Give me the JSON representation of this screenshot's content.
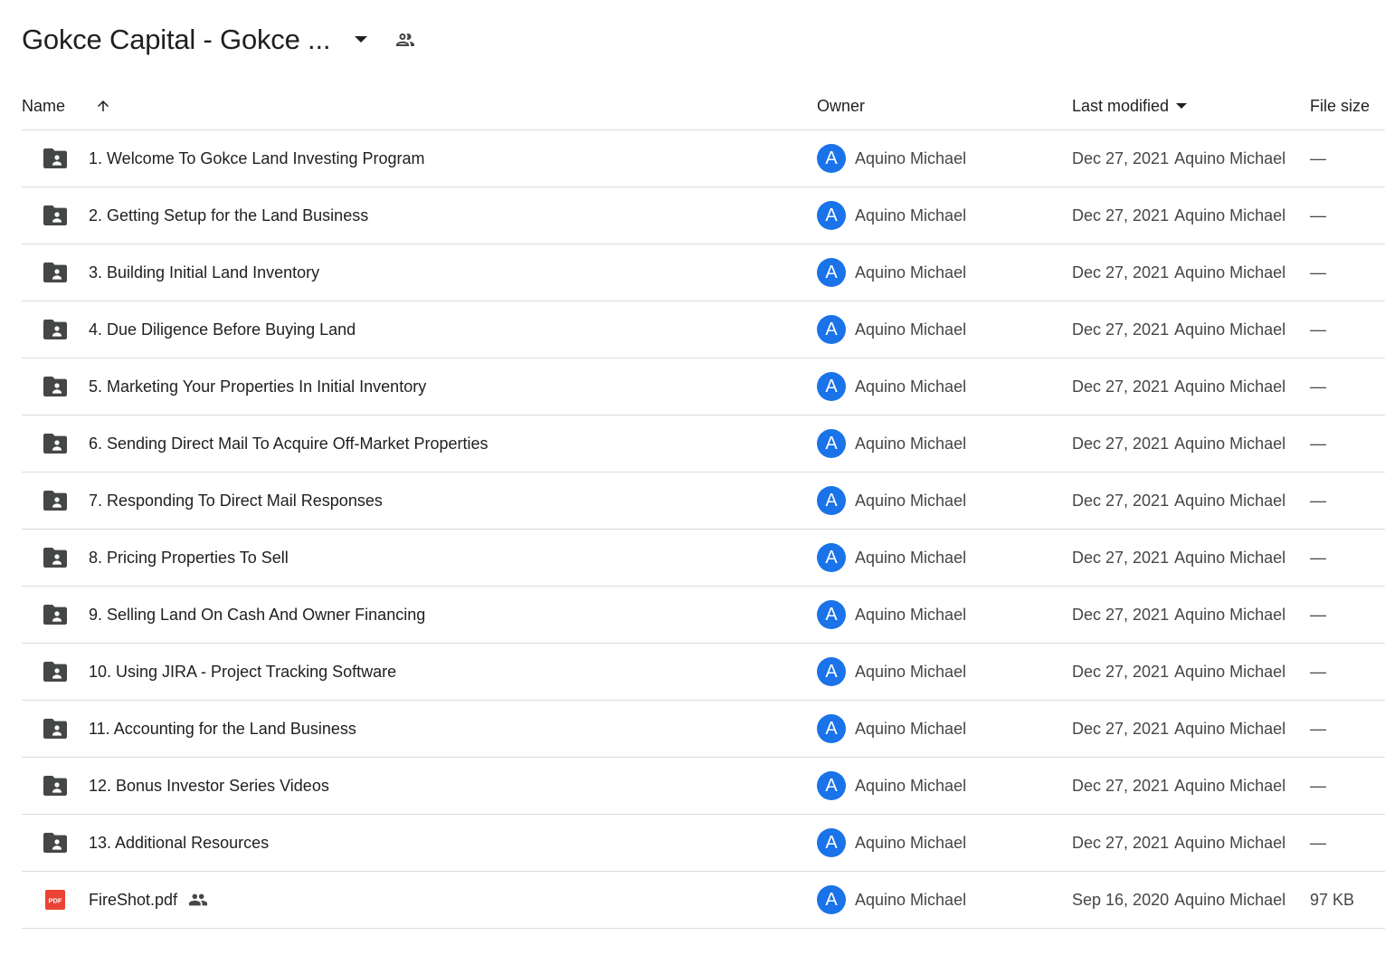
{
  "header": {
    "title": "Gokce Capital - Gokce ...",
    "caret_icon": "arrow-drop-down-icon",
    "shared_icon": "people-icon"
  },
  "columns": {
    "name": "Name",
    "owner": "Owner",
    "last_modified": "Last modified",
    "file_size": "File size",
    "sort_icon": "arrow-up-icon"
  },
  "colors": {
    "avatar_bg": "#1a73e8",
    "folder_icon": "#444746",
    "pdf_icon": "#ea4335",
    "divider": "#dadce0"
  },
  "rows": [
    {
      "type": "folder",
      "name": "1. Welcome To Gokce Land Investing Program",
      "owner_initial": "A",
      "owner": "Aquino Michael",
      "modified_date": "Dec 27, 2021",
      "modified_by": "Aquino Michael",
      "size": "—"
    },
    {
      "type": "folder",
      "name": "2. Getting Setup for the Land Business",
      "owner_initial": "A",
      "owner": "Aquino Michael",
      "modified_date": "Dec 27, 2021",
      "modified_by": "Aquino Michael",
      "size": "—"
    },
    {
      "type": "folder",
      "name": "3. Building Initial Land Inventory",
      "owner_initial": "A",
      "owner": "Aquino Michael",
      "modified_date": "Dec 27, 2021",
      "modified_by": "Aquino Michael",
      "size": "—"
    },
    {
      "type": "folder",
      "name": "4. Due Diligence Before Buying Land",
      "owner_initial": "A",
      "owner": "Aquino Michael",
      "modified_date": "Dec 27, 2021",
      "modified_by": "Aquino Michael",
      "size": "—"
    },
    {
      "type": "folder",
      "name": "5. Marketing Your Properties In Initial Inventory",
      "owner_initial": "A",
      "owner": "Aquino Michael",
      "modified_date": "Dec 27, 2021",
      "modified_by": "Aquino Michael",
      "size": "—"
    },
    {
      "type": "folder",
      "name": "6. Sending Direct Mail To Acquire Off-Market Properties",
      "owner_initial": "A",
      "owner": "Aquino Michael",
      "modified_date": "Dec 27, 2021",
      "modified_by": "Aquino Michael",
      "size": "—"
    },
    {
      "type": "folder",
      "name": "7. Responding To Direct Mail Responses",
      "owner_initial": "A",
      "owner": "Aquino Michael",
      "modified_date": "Dec 27, 2021",
      "modified_by": "Aquino Michael",
      "size": "—"
    },
    {
      "type": "folder",
      "name": "8. Pricing Properties To Sell",
      "owner_initial": "A",
      "owner": "Aquino Michael",
      "modified_date": "Dec 27, 2021",
      "modified_by": "Aquino Michael",
      "size": "—"
    },
    {
      "type": "folder",
      "name": "9. Selling Land On Cash And Owner Financing",
      "owner_initial": "A",
      "owner": "Aquino Michael",
      "modified_date": "Dec 27, 2021",
      "modified_by": "Aquino Michael",
      "size": "—"
    },
    {
      "type": "folder",
      "name": "10. Using JIRA - Project Tracking Software",
      "owner_initial": "A",
      "owner": "Aquino Michael",
      "modified_date": "Dec 27, 2021",
      "modified_by": "Aquino Michael",
      "size": "—"
    },
    {
      "type": "folder",
      "name": "11. Accounting for the Land Business",
      "owner_initial": "A",
      "owner": "Aquino Michael",
      "modified_date": "Dec 27, 2021",
      "modified_by": "Aquino Michael",
      "size": "—"
    },
    {
      "type": "folder",
      "name": "12. Bonus Investor Series Videos",
      "owner_initial": "A",
      "owner": "Aquino Michael",
      "modified_date": "Dec 27, 2021",
      "modified_by": "Aquino Michael",
      "size": "—"
    },
    {
      "type": "folder",
      "name": "13. Additional Resources",
      "owner_initial": "A",
      "owner": "Aquino Michael",
      "modified_date": "Dec 27, 2021",
      "modified_by": "Aquino Michael",
      "size": "—"
    },
    {
      "type": "pdf",
      "name": "FireShot.pdf",
      "shared": true,
      "owner_initial": "A",
      "owner": "Aquino Michael",
      "modified_date": "Sep 16, 2020",
      "modified_by": "Aquino Michael",
      "size": "97 KB"
    }
  ]
}
